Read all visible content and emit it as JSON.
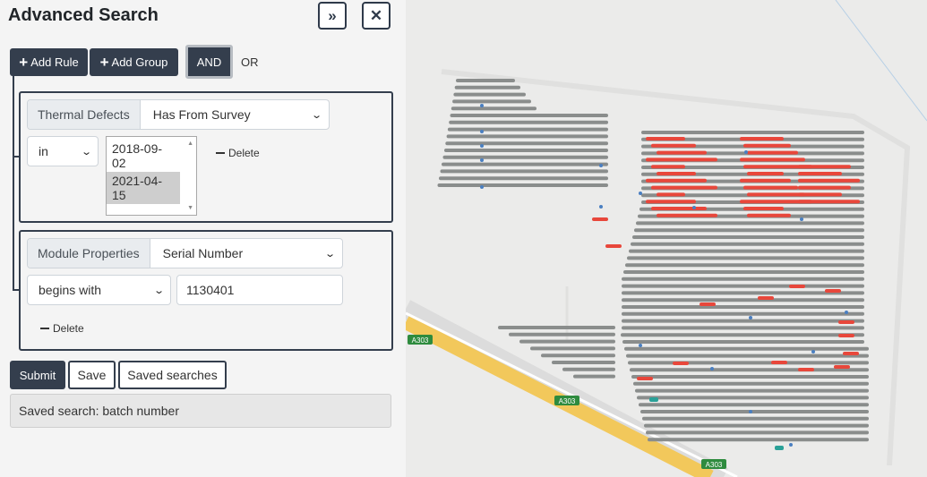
{
  "panel": {
    "title": "Advanced Search",
    "expand_icon": "»",
    "close_icon": "✕"
  },
  "toolbar": {
    "add_rule_label": "Add Rule",
    "add_group_label": "Add Group",
    "plus_icon": "+",
    "and_label": "AND",
    "or_label": "OR"
  },
  "rules": [
    {
      "category": "Thermal Defects",
      "property": "Has From Survey",
      "operator": "in",
      "options": [
        "2018-09-02",
        "2021-04-15"
      ],
      "selected_option": "2021-04-15",
      "delete_label": "Delete"
    },
    {
      "category": "Module Properties",
      "property": "Serial Number",
      "operator": "begins with",
      "value": "1130401",
      "delete_label": "Delete"
    }
  ],
  "actions": {
    "submit_label": "Submit",
    "save_label": "Save",
    "saved_searches_label": "Saved searches"
  },
  "status": {
    "saved_search_text": "Saved search: batch number"
  },
  "map": {
    "road_labels": [
      "A303",
      "A303",
      "A303"
    ],
    "colors": {
      "background": "#ebebea",
      "panel_rows": "#8a8d8c",
      "defect_marker": "#e8473b",
      "module_marker": "#4a7fc1",
      "road": "#f2c85b",
      "road_label_bg": "#2e8b3e"
    }
  }
}
